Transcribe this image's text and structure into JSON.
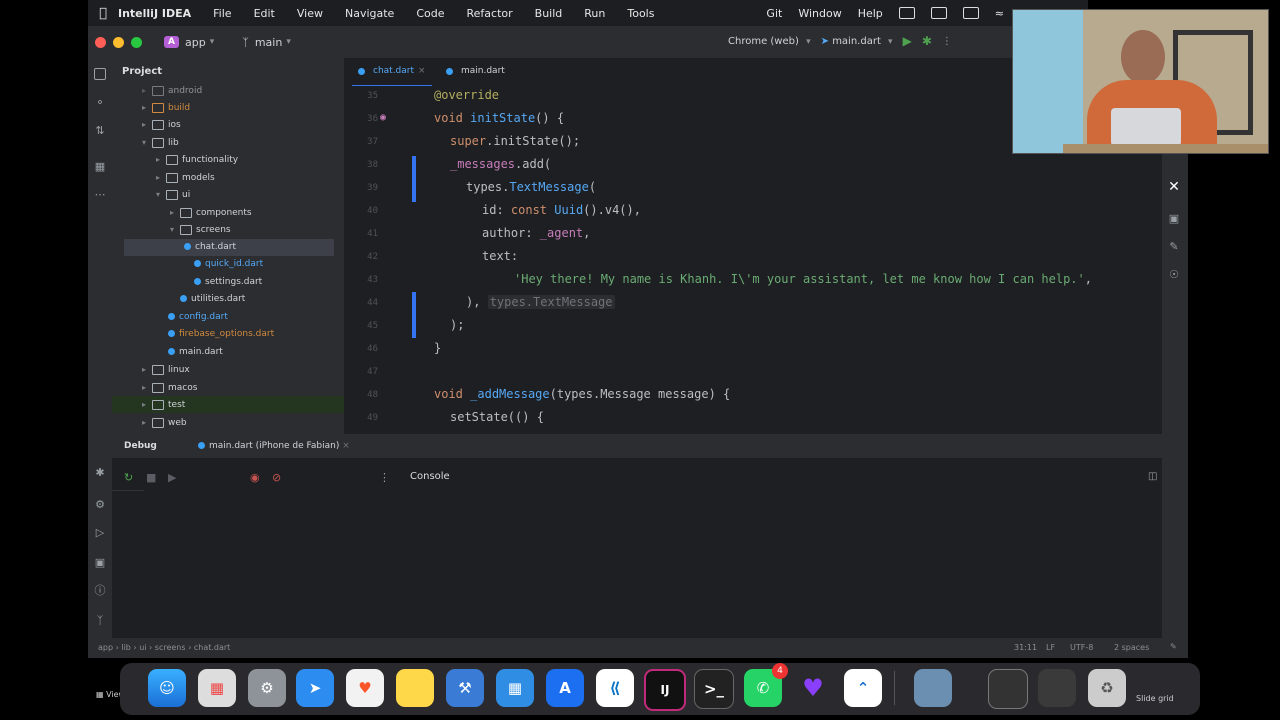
{
  "menubar": {
    "app_name": "IntelliJ IDEA",
    "items": [
      "File",
      "Edit",
      "View",
      "Navigate",
      "Code",
      "Refactor",
      "Build",
      "Run",
      "Tools",
      "Git",
      "Window",
      "Help"
    ]
  },
  "titlebar": {
    "project_badge": "A",
    "project": "app",
    "branch": "main",
    "device": "Chrome (web)",
    "run_config": "main.dart"
  },
  "project_panel": {
    "title": "Project",
    "rows": [
      "android",
      "build",
      "ios",
      "lib",
      "functionality",
      "models",
      "ui",
      "components",
      "screens",
      "chat.dart",
      "quick_id.dart",
      "settings.dart",
      "utilities.dart",
      "config.dart",
      "firebase_options.dart",
      "main.dart",
      "linux",
      "macos",
      "test",
      "web"
    ]
  },
  "tabs": [
    {
      "label": "chat.dart"
    },
    {
      "label": "main.dart"
    }
  ],
  "editor": {
    "line_numbers": [
      "35",
      "36",
      "37",
      "38",
      "39",
      "40",
      "41",
      "42",
      "43",
      "44",
      "45",
      "46",
      "47",
      "48",
      "49"
    ],
    "l0": "@override",
    "l1_kw": "void",
    "l1_fn": "initState",
    "l1_rest": "() {",
    "l2_kw": "super",
    "l2_rest": ".initState();",
    "l3_fld": "_messages",
    "l3_rest": ".add(",
    "l4_pre": "types.",
    "l4_ty": "TextMessage",
    "l4_rest": "(",
    "l5_pre": "id: ",
    "l5_kw": "const",
    "l5_ty": "Uuid",
    "l5_rest": "().v4(),",
    "l6_pre": "author: ",
    "l6_fld": "_agent",
    "l6_rest": ",",
    "l7": "text:",
    "l8_str": "'Hey there! My name is Khanh. I\\'m your assistant, let me know how I can help.'",
    "l8_rest": ",",
    "l9": "),",
    "l9_hint": "types.TextMessage",
    "l10": ");",
    "l11": "}",
    "l13_kw": "void",
    "l13_fn": "_addMessage",
    "l13_rest": "(types.Message message) {",
    "l14": "setState(() {"
  },
  "debug": {
    "label": "Debug",
    "session": "main.dart (iPhone de Fabian)",
    "console_tab": "Console"
  },
  "statusbar": {
    "breadcrumb": [
      "app",
      "lib",
      "ui",
      "screens",
      "chat.dart"
    ],
    "position": "31:11",
    "line_sep": "LF",
    "encoding": "UTF-8",
    "indent": "2 spaces"
  },
  "dock": {
    "left_label": "View",
    "right_label": "Slide grid",
    "badge_count": "4"
  },
  "colors": {
    "accent": "#3574f0",
    "bg": "#1e1f22",
    "panel": "#2b2d30"
  }
}
